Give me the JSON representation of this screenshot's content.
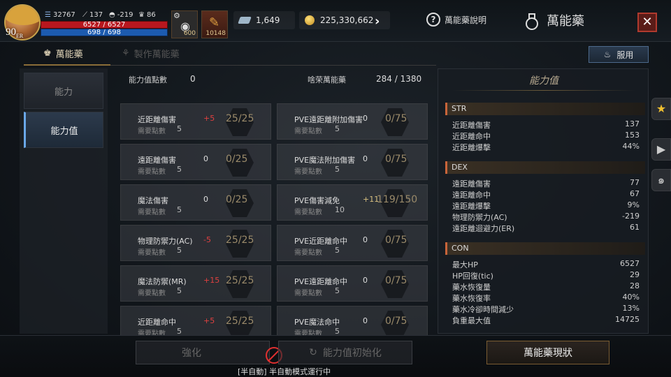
{
  "player": {
    "level": "90",
    "level_tag": "ER",
    "power": "32767",
    "atk": "137",
    "ac": "-219",
    "trophy": "86",
    "hp": "6527 / 6527",
    "mp": "698 / 698"
  },
  "items": [
    {
      "count": "600"
    },
    {
      "count": "10148"
    }
  ],
  "currency": {
    "gems": "1,649",
    "gold": "225,330,662"
  },
  "help_label": "萬能藥說明",
  "page_title": "萬能藥",
  "tabs": [
    "萬能藥",
    "製作萬能藥"
  ],
  "use_label": "服用",
  "nav": [
    "能力",
    "能力值"
  ],
  "header": {
    "points_label": "能力值點數",
    "points_value": "0",
    "total_label": "啥荣萬能藥",
    "total_value": "284 / 1380"
  },
  "req_label": "需要點數",
  "left_cards": [
    {
      "name": "近距離傷害",
      "bonus": "+5",
      "progress": "25/25",
      "req": "5"
    },
    {
      "name": "遠距離傷害",
      "bonus": "0",
      "progress": "0/25",
      "req": "5"
    },
    {
      "name": "魔法傷害",
      "bonus": "0",
      "progress": "0/25",
      "req": "5"
    },
    {
      "name": "物理防禦力(AC)",
      "bonus": "-5",
      "progress": "25/25",
      "req": "5"
    },
    {
      "name": "魔法防禦(MR)",
      "bonus": "+15",
      "progress": "25/25",
      "req": "5"
    },
    {
      "name": "近距離命中",
      "bonus": "+5",
      "progress": "25/25",
      "req": "5"
    }
  ],
  "right_cards": [
    {
      "name": "PVE遠距離附加傷害",
      "bonus": "0",
      "progress": "0/75",
      "req": "5"
    },
    {
      "name": "PVE魔法附加傷害",
      "bonus": "0",
      "progress": "0/75",
      "req": "5"
    },
    {
      "name": "PVE傷害減免",
      "bonus": "+11",
      "progress": "119/150",
      "req": "10"
    },
    {
      "name": "PVE近距離命中",
      "bonus": "0",
      "progress": "0/75",
      "req": "5"
    },
    {
      "name": "PVE遠距離命中",
      "bonus": "0",
      "progress": "0/75",
      "req": "5"
    },
    {
      "name": "PVE魔法命中",
      "bonus": "0",
      "progress": "0/75",
      "req": "5"
    }
  ],
  "stats_panel": {
    "title": "能力值",
    "sections": [
      {
        "name": "STR",
        "rows": [
          [
            "近距離傷害",
            "137"
          ],
          [
            "近距離命中",
            "153"
          ],
          [
            "近距離爆擊",
            "44%"
          ]
        ]
      },
      {
        "name": "DEX",
        "rows": [
          [
            "遠距離傷害",
            "77"
          ],
          [
            "遠距離命中",
            "67"
          ],
          [
            "遠距離爆擊",
            "9%"
          ],
          [
            "物理防禦力(AC)",
            "-219"
          ],
          [
            "遠距離迴避力(ER)",
            "61"
          ]
        ]
      },
      {
        "name": "CON",
        "rows": [
          [
            "最大HP",
            "6527"
          ],
          [
            "HP回復(tic)",
            "29"
          ],
          [
            "藥水恢復量",
            "28"
          ],
          [
            "藥水恢復率",
            "40%"
          ],
          [
            "藥水冷卻時間減少",
            "13%"
          ],
          [
            "負重最大值",
            "14725"
          ]
        ]
      }
    ]
  },
  "bottom": {
    "b1": "強化",
    "b2": "能力值初始化",
    "b3": "萬能藥現狀",
    "auto_msg": "[半自動] 半自動模式運行中"
  }
}
